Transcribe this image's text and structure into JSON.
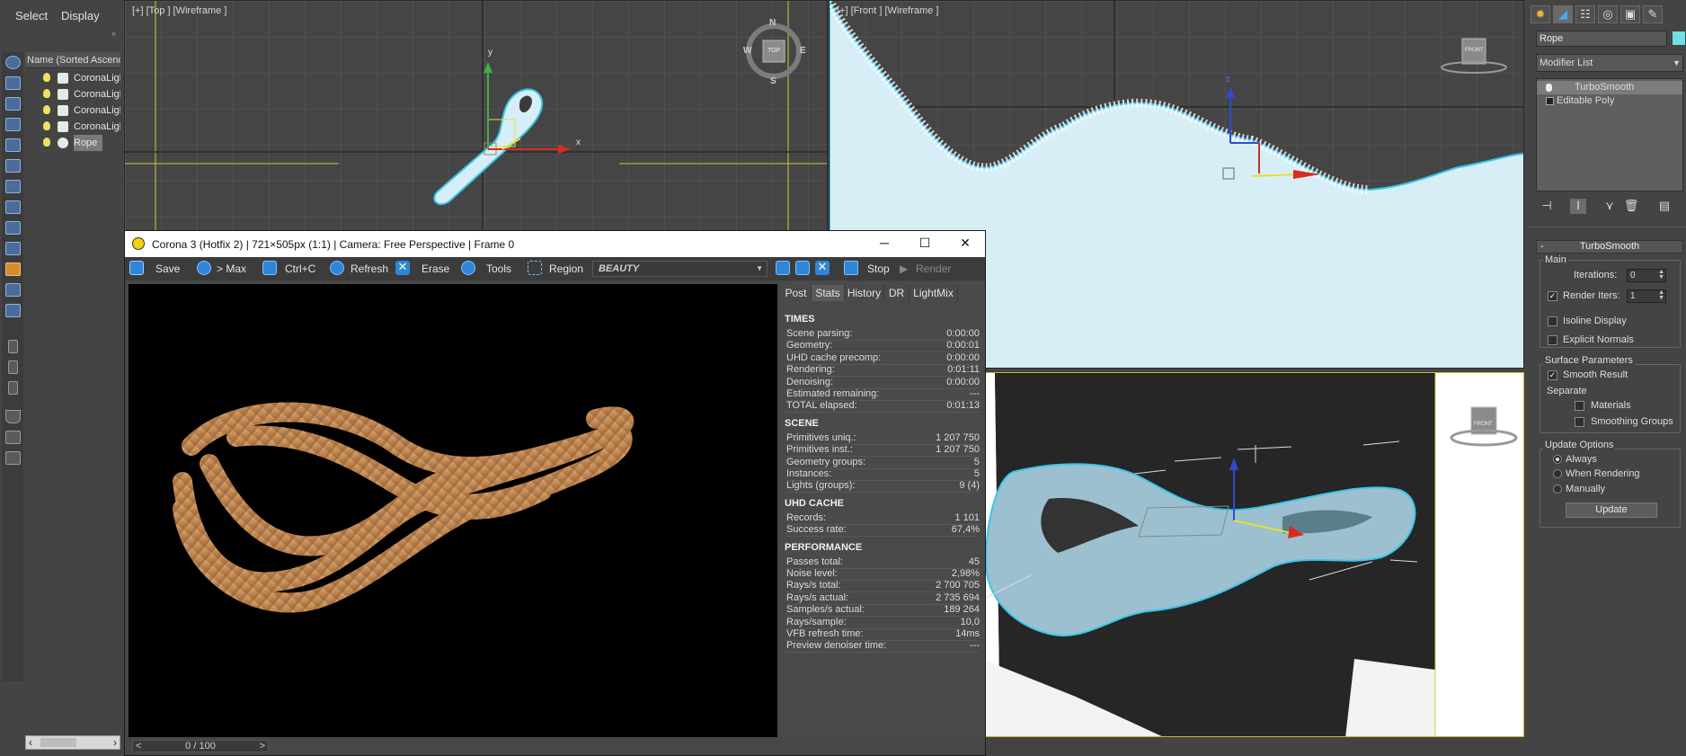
{
  "menu": {
    "select": "Select",
    "display": "Display"
  },
  "explorer": {
    "header": "Name (Sorted Ascend",
    "rows": [
      {
        "label": "CoronaLigh",
        "type": "light"
      },
      {
        "label": "CoronaLigh",
        "type": "light"
      },
      {
        "label": "CoronaLigh",
        "type": "light"
      },
      {
        "label": "CoronaLigh",
        "type": "light"
      },
      {
        "label": "Rope",
        "type": "geometry",
        "selected": true
      }
    ]
  },
  "viewports": {
    "top": {
      "label": "[+] [Top ] [Wireframe ]",
      "axis_y": "y",
      "axis_x": "x",
      "compass": [
        "N",
        "S",
        "E",
        "W",
        "TOP"
      ]
    },
    "front": {
      "label": "[+] [Front ] [Wireframe ]",
      "axis_z": "z",
      "cube": "FRONT"
    },
    "perspective": {
      "cube": "FRONT"
    }
  },
  "command_panel": {
    "object_name": "Rope",
    "object_color": "#6fe0e6",
    "modifier_list": "Modifier List",
    "stack": [
      {
        "label": "TurboSmooth",
        "selected": true
      },
      {
        "label": "Editable Poly",
        "selected": false
      }
    ],
    "rollout_title": "TurboSmooth",
    "main": {
      "group": "Main",
      "iterations_label": "Iterations:",
      "iterations_value": "0",
      "render_iters_label": "Render Iters:",
      "render_iters_checked": true,
      "render_iters_value": "1",
      "isoline_label": "Isoline Display",
      "explicit_label": "Explicit Normals"
    },
    "surface": {
      "group": "Surface Parameters",
      "smooth_label": "Smooth Result",
      "smooth_checked": true,
      "separate_label": "Separate",
      "materials_label": "Materials",
      "smoothing_label": "Smoothing Groups"
    },
    "update": {
      "group": "Update Options",
      "always": "Always",
      "when_rendering": "When Rendering",
      "manually": "Manually",
      "selected": "Always",
      "button": "Update"
    }
  },
  "vfb": {
    "title": "Corona 3 (Hotfix 2) | 721×505px (1:1) | Camera: Free Perspective | Frame 0",
    "toolbar": {
      "save": "Save",
      "max": "> Max",
      "copy": "Ctrl+C",
      "refresh": "Refresh",
      "erase": "Erase",
      "tools": "Tools",
      "region": "Region",
      "channel": "BEAUTY",
      "stop": "Stop",
      "render": "Render"
    },
    "frame_counter": "0 / 100",
    "tabs": [
      "Post",
      "Stats",
      "History",
      "DR",
      "LightMix"
    ],
    "active_tab": "Stats",
    "stats": {
      "times": {
        "title": "TIMES",
        "rows": [
          {
            "k": "Scene parsing:",
            "v": "0:00:00"
          },
          {
            "k": "Geometry:",
            "v": "0:00:01"
          },
          {
            "k": "UHD cache precomp:",
            "v": "0:00:00"
          },
          {
            "k": "Rendering:",
            "v": "0:01:11"
          },
          {
            "k": "Denoising:",
            "v": "0:00:00"
          },
          {
            "k": "Estimated remaining:",
            "v": "---"
          },
          {
            "k": "TOTAL elapsed:",
            "v": "0:01:13"
          }
        ]
      },
      "scene": {
        "title": "SCENE",
        "rows": [
          {
            "k": "Primitives uniq.:",
            "v": "1 207 750"
          },
          {
            "k": "Primitives inst.:",
            "v": "1 207 750"
          },
          {
            "k": "Geometry groups:",
            "v": "5"
          },
          {
            "k": "Instances:",
            "v": "5"
          },
          {
            "k": "Lights (groups):",
            "v": "9 (4)"
          }
        ]
      },
      "uhd": {
        "title": "UHD CACHE",
        "rows": [
          {
            "k": "Records:",
            "v": "1 101"
          },
          {
            "k": "Success rate:",
            "v": "67,4%"
          }
        ]
      },
      "perf": {
        "title": "PERFORMANCE",
        "rows": [
          {
            "k": "Passes total:",
            "v": "45"
          },
          {
            "k": "Noise level:",
            "v": "2,98%"
          },
          {
            "k": "Rays/s total:",
            "v": "2 700 705"
          },
          {
            "k": "Rays/s actual:",
            "v": "2 735 694"
          },
          {
            "k": "Samples/s actual:",
            "v": "189 264"
          },
          {
            "k": "Rays/sample:",
            "v": "10,0"
          },
          {
            "k": "VFB refresh time:",
            "v": "14ms"
          },
          {
            "k": "Preview denoiser time:",
            "v": "---"
          }
        ]
      }
    }
  }
}
